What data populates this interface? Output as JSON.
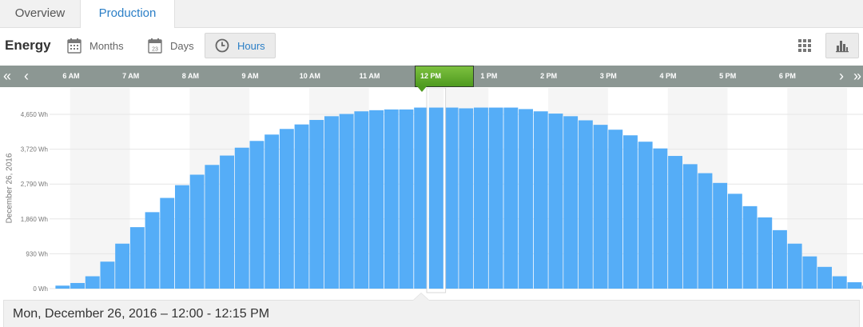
{
  "tabs": [
    {
      "label": "Overview",
      "active": false
    },
    {
      "label": "Production",
      "active": true
    }
  ],
  "toolbar": {
    "title": "Energy",
    "months_label": "Months",
    "days_label": "Days",
    "hours_label": "Hours",
    "days_icon_text": "23",
    "active_period": "Hours",
    "active_view": "bar-chart"
  },
  "timeline": {
    "hours": [
      "6 AM",
      "7 AM",
      "8 AM",
      "9 AM",
      "10 AM",
      "11 AM",
      "12 PM",
      "1 PM",
      "2 PM",
      "3 PM",
      "4 PM",
      "5 PM",
      "6 PM"
    ],
    "selected_label": "12 PM",
    "first_label": "«",
    "prev_label": "‹",
    "next_label": "›",
    "last_label": "»"
  },
  "colors": {
    "bar": "#55adf7",
    "timeline": "#8c9793",
    "selected": "#5fa82a",
    "accent": "#2a7ec6"
  },
  "chart_data": {
    "type": "bar",
    "ylabel": "December 26, 2016",
    "yticks": [
      "0 Wh",
      "930 Wh",
      "1,860 Wh",
      "2,790 Wh",
      "3,720 Wh",
      "4,650 Wh"
    ],
    "ylim": [
      0,
      5580
    ],
    "grid": true,
    "x_start_hour": 5.75,
    "interval_minutes": 15,
    "selected_index": 25,
    "values": [
      80,
      150,
      330,
      720,
      1200,
      1640,
      2040,
      2420,
      2760,
      3040,
      3300,
      3550,
      3760,
      3940,
      4110,
      4260,
      4380,
      4500,
      4600,
      4660,
      4730,
      4760,
      4780,
      4780,
      4830,
      4830,
      4830,
      4810,
      4830,
      4830,
      4830,
      4790,
      4730,
      4670,
      4600,
      4490,
      4370,
      4240,
      4090,
      3920,
      3740,
      3540,
      3320,
      3080,
      2820,
      2530,
      2200,
      1900,
      1560,
      1200,
      860,
      580,
      330,
      170,
      80,
      40,
      20
    ],
    "bar_range": "12:00 - 12:15 PM"
  },
  "info": {
    "selected_text": "Mon, December 26, 2016 – 12:00 - 12:15 PM"
  }
}
